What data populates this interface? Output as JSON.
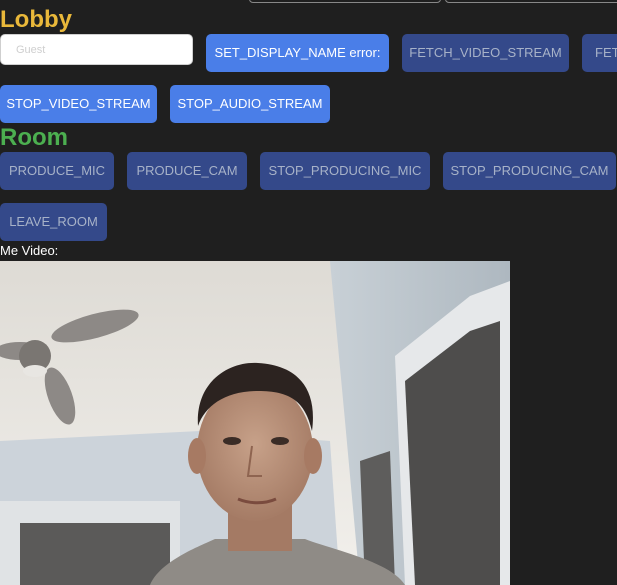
{
  "lobby": {
    "heading": "Lobby",
    "heading_color": "#e9b83a",
    "name_placeholder": "Guest",
    "buttons": [
      {
        "label": "SET_DISPLAY_NAME error:",
        "state": "active"
      },
      {
        "label": "FETCH_VIDEO_STREAM",
        "state": "disabled"
      },
      {
        "label": "FET",
        "state": "disabled"
      },
      {
        "label": "STOP_VIDEO_STREAM",
        "state": "active"
      },
      {
        "label": "STOP_AUDIO_STREAM",
        "state": "active"
      }
    ]
  },
  "room": {
    "heading": "Room",
    "heading_color": "#4caf50",
    "buttons": [
      {
        "label": "PRODUCE_MIC",
        "state": "disabled"
      },
      {
        "label": "PRODUCE_CAM",
        "state": "disabled"
      },
      {
        "label": "STOP_PRODUCING_MIC",
        "state": "disabled"
      },
      {
        "label": "STOP_PRODUCING_CAM",
        "state": "disabled"
      },
      {
        "label": "LEAVE_ROOM",
        "state": "disabled"
      }
    ]
  },
  "me_video": {
    "label": "Me Video:",
    "content": "webcam-feed"
  },
  "colors": {
    "background": "#1f1f1f",
    "button_active": "#4a7ee8",
    "button_disabled": "#34498a",
    "button_disabled_text": "#a7b2c8"
  }
}
